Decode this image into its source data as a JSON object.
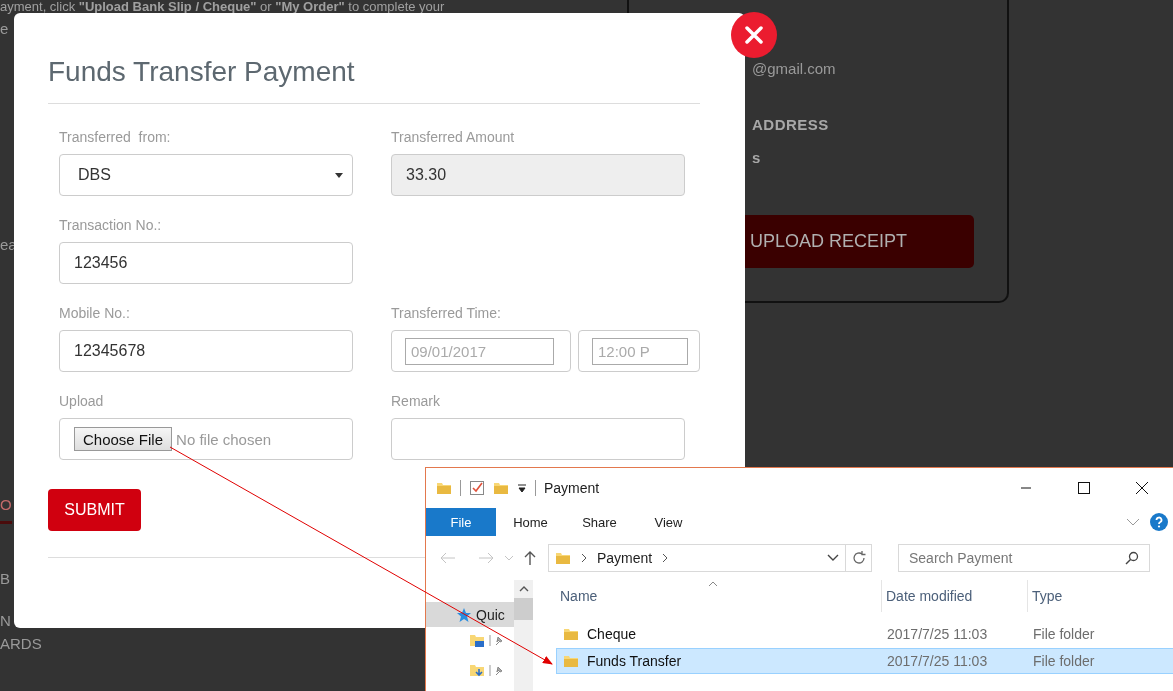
{
  "background_page": {
    "notice": "ayment, click **\"Upload Bank Slip / Cheque\"** or **\"My Order\"** to complete your",
    "notice_line_2": "e",
    "side_texts": [
      {
        "kind": "plain",
        "text": "ea"
      },
      {
        "kind": "tab",
        "text": "O"
      },
      {
        "kind": "plain",
        "text": "B"
      },
      {
        "kind": "plain",
        "text": "N"
      },
      {
        "kind": "plain",
        "text": "ARDS"
      }
    ],
    "card": {
      "email": "@gmail.com",
      "heading": "ADDRESS",
      "line": "s",
      "button": "UPLOAD RECEIPT"
    }
  },
  "modal": {
    "title": "Funds Transfer Payment",
    "rows": [
      [
        {
          "kind": "select",
          "label": "Transferred  from:",
          "value": "DBS"
        },
        {
          "kind": "readonly",
          "label": "Transferred Amount",
          "value": "33.30"
        }
      ],
      [
        {
          "kind": "text",
          "label": "Transaction No.:",
          "value": "123456"
        }
      ],
      [
        {
          "kind": "text",
          "label": "Mobile No.:",
          "value": "12345678"
        },
        {
          "kind": "datetime",
          "label": "Transferred Time:",
          "date": "09/01/2017",
          "time": "12:00 P"
        }
      ],
      [
        {
          "kind": "file",
          "label": "Upload",
          "button": "Choose File",
          "status": "No file chosen"
        },
        {
          "kind": "textarea",
          "label": "Remark"
        }
      ]
    ],
    "submit": "SUBMIT"
  },
  "explorer": {
    "title": "Payment",
    "ribbon_tabs": [
      {
        "label": "File",
        "selected": true
      },
      {
        "label": "Home",
        "selected": false
      },
      {
        "label": "Share",
        "selected": false
      },
      {
        "label": "View",
        "selected": false
      }
    ],
    "address": "Payment",
    "search": {
      "placeholder": "Search Payment"
    },
    "nav_items": [
      {
        "kind": "star",
        "label": "Quic",
        "selected": true
      },
      {
        "kind": "desktop",
        "selected": false
      },
      {
        "kind": "downloads",
        "selected": false
      }
    ],
    "columns": [
      "Name",
      "Date modified",
      "Type"
    ],
    "rows": [
      {
        "name": "Cheque",
        "date": "2017/7/25 11:03",
        "type": "File folder",
        "selected": false
      },
      {
        "name": "Funds Transfer",
        "date": "2017/7/25 11:03",
        "type": "File folder",
        "selected": true
      }
    ]
  }
}
